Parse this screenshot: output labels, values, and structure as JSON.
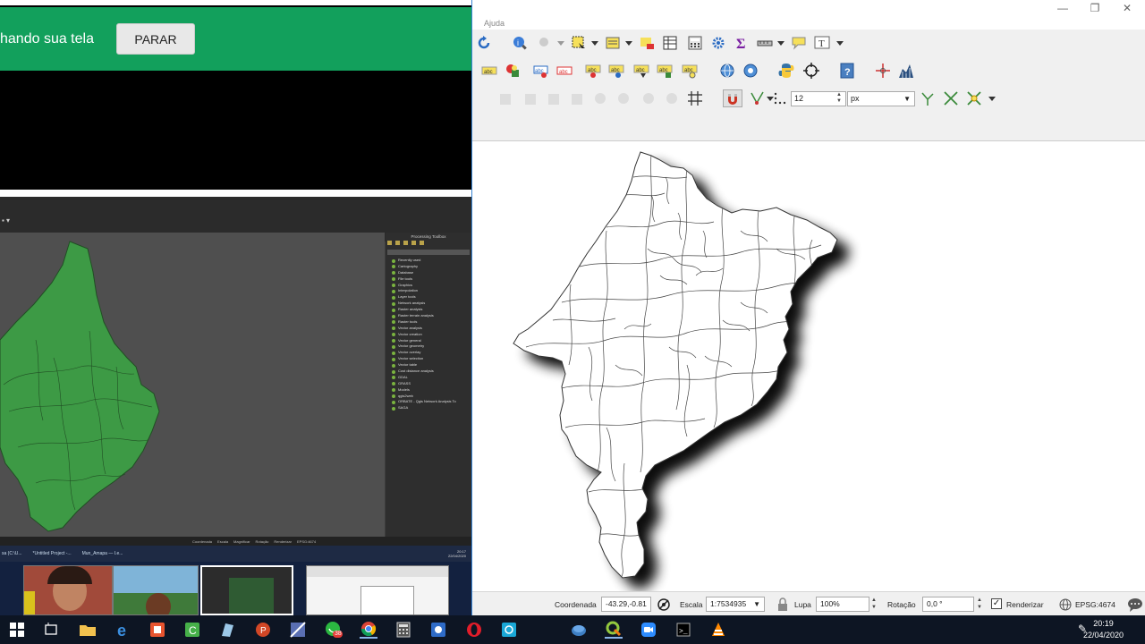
{
  "share_bar": {
    "message": "hando sua tela",
    "stop_button": "PARAR"
  },
  "inner_window": {
    "toolbox_title": "Processing Toolbox",
    "toolbox_items": [
      "Recently used",
      "Cartography",
      "Database",
      "File tools",
      "Graphics",
      "Interpolation",
      "Layer tools",
      "Network analysis",
      "Raster analysis",
      "Raster terrain analysis",
      "Raster tools",
      "Vector analysis",
      "Vector creation",
      "Vector general",
      "Vector geometry",
      "Vector overlay",
      "Vector selection",
      "Vector table",
      "Cost distance analysis",
      "GDAL",
      "GRASS",
      "Models",
      "qgis2web",
      "ORBATE - Qgis Network Analysis To",
      "SAGA"
    ],
    "status_items": [
      "Coordenada",
      "Escala",
      "Magnificar",
      "Rotação",
      "Renderizar",
      "EPSG:4674"
    ],
    "tasks": [
      "sa (C:\\U...",
      "*Untitled Project -...",
      "Mun_Amapa — I.e..."
    ],
    "clock_time": "20:17",
    "clock_date": "22/04/2020"
  },
  "qgis": {
    "menu_partial": "Ajuda",
    "window_buttons": {
      "minimize": "—",
      "restore": "❐",
      "close": "✕"
    },
    "snap_tolerance": "12",
    "snap_unit": "px",
    "status": {
      "coord_label": "Coordenada",
      "coord_value": "-43.29,-0.81",
      "scale_label": "Escala",
      "scale_value": "1:7534935",
      "mag_label": "Lupa",
      "mag_value": "100%",
      "rot_label": "Rotação",
      "rot_value": "0,0 °",
      "render_label": "Renderizar",
      "crs": "EPSG:4674"
    },
    "colors": {
      "accent": "#3a85d3",
      "feature_fill": "#ffffff",
      "feature_stroke": "#333333"
    }
  },
  "share_colors": {
    "bar": "#12a05c",
    "map_green": "#3d9a45"
  },
  "taskbar": {
    "apps": [
      "windows-start",
      "task-view",
      "file-explorer",
      "edge",
      "app-orange",
      "app-green",
      "app-notes",
      "powerpoint",
      "app-gvsig",
      "whatsapp",
      "chrome",
      "calculator",
      "app-blue",
      "opera",
      "app-cyan",
      "app-azure",
      "qgis",
      "zoom",
      "cmd",
      "vlc"
    ],
    "whatsapp_badge": "38",
    "clock_time": "20:19",
    "clock_date": "22/04/2020"
  }
}
